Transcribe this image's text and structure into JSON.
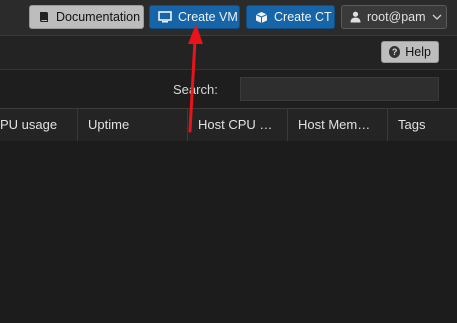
{
  "topbar": {
    "documentation_label": "Documentation",
    "create_vm_label": "Create VM",
    "create_ct_label": "Create CT",
    "user_label": "root@pam"
  },
  "toolbar": {
    "help_label": "Help"
  },
  "search": {
    "label": "Search:",
    "value": ""
  },
  "table": {
    "columns": [
      "PU usage",
      "Uptime",
      "Host CPU …",
      "Host Mem…",
      "Tags"
    ]
  },
  "annotation": {
    "arrow_color": "#e8141c"
  },
  "icons": {
    "documentation": "book-icon",
    "create_vm": "monitor-icon",
    "create_ct": "cube-icon",
    "user": "user-icon",
    "user_menu": "chevron-down-icon",
    "help": "question-circle-icon"
  }
}
